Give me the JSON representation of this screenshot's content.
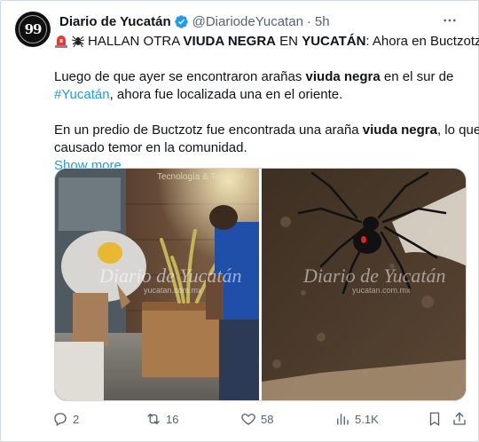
{
  "author": {
    "avatar_text": "99",
    "display_name": "Diario de Yucatán",
    "handle": "@DiariodeYucatan",
    "separator": "·",
    "time": "5h"
  },
  "tweet": {
    "line1": {
      "prefix": "HALLAN OTRA ",
      "bold1": "VIUDA NEGRA",
      "mid": " EN ",
      "bold2": "YUCATÁN",
      "suffix": ": Ahora en Buctzotz."
    },
    "line2": {
      "prefix": "Luego de que ayer se encontraron arañas ",
      "bold": "viuda negra",
      "suffix": " en el sur de"
    },
    "line3": {
      "hashtag": "#Yucatán",
      "suffix": ", ahora fue localizada una en el oriente."
    },
    "line4": {
      "prefix": "En un predio de Buctzotz fue encontrada una araña ",
      "bold": "viuda negra",
      "suffix": ", lo que ha"
    },
    "line5": "causado temor en la comunidad.",
    "show_more": "Show more"
  },
  "media": {
    "left_image": {
      "watermark_top": "Tecnología & Telecom",
      "watermark": "Diario de Yucatán",
      "watermark_url": "yucatan.com.mx"
    },
    "right_image": {
      "watermark": "Diario de Yucatán",
      "watermark_url": "yucatan.com.mx"
    }
  },
  "actions": {
    "replies": "2",
    "reposts": "16",
    "likes": "58",
    "views": "5.1K"
  },
  "icons": {
    "emoji1": "police-light-icon",
    "emoji2": "spider-icon",
    "verified": "verified-badge-icon",
    "more": "more-dots-icon",
    "reply": "reply-icon",
    "repost": "repost-icon",
    "like": "heart-icon",
    "views": "views-icon",
    "bookmark": "bookmark-icon",
    "share": "share-icon"
  },
  "colors": {
    "accent": "#1d9bf0",
    "secondary_text": "#536471",
    "border": "#cfd9de"
  }
}
